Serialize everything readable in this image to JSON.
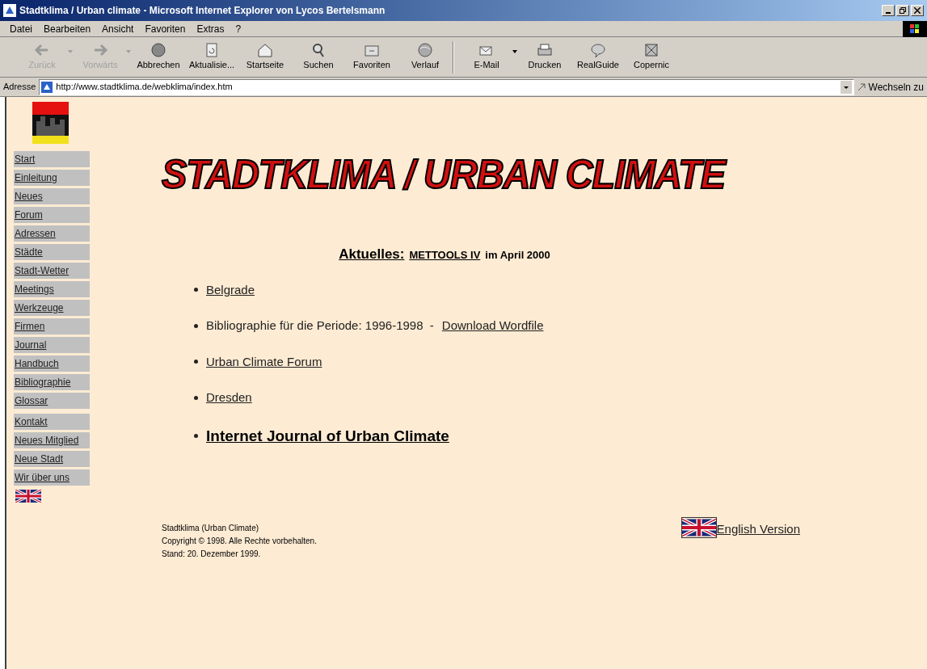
{
  "window": {
    "title": "Stadtklima / Urban climate - Microsoft Internet Explorer von Lycos Bertelsmann"
  },
  "menu": [
    "Datei",
    "Bearbeiten",
    "Ansicht",
    "Favoriten",
    "Extras",
    "?"
  ],
  "toolbar": [
    {
      "label": "Zurück",
      "kind": "back",
      "disabled": true,
      "dropdown": true
    },
    {
      "label": "Vorwärts",
      "kind": "forward",
      "disabled": true,
      "dropdown": true
    },
    {
      "label": "Abbrechen",
      "kind": "stop",
      "disabled": false,
      "dropdown": false
    },
    {
      "label": "Aktualisie...",
      "kind": "refresh",
      "disabled": false,
      "dropdown": false
    },
    {
      "label": "Startseite",
      "kind": "home",
      "disabled": false,
      "dropdown": false
    },
    {
      "label": "Suchen",
      "kind": "search",
      "disabled": false,
      "dropdown": false
    },
    {
      "label": "Favoriten",
      "kind": "favorites",
      "disabled": false,
      "dropdown": false
    },
    {
      "label": "Verlauf",
      "kind": "history",
      "disabled": false,
      "dropdown": false
    },
    {
      "label": "E-Mail",
      "kind": "mail",
      "disabled": false,
      "dropdown": true
    },
    {
      "label": "Drucken",
      "kind": "print",
      "disabled": false,
      "dropdown": false
    },
    {
      "label": "RealGuide",
      "kind": "realguide",
      "disabled": false,
      "dropdown": false
    },
    {
      "label": "Copernic",
      "kind": "copernic",
      "disabled": false,
      "dropdown": false
    }
  ],
  "address_bar": {
    "label": "Adresse",
    "url": "http://www.stadtklima.de/webklima/index.htm",
    "go": "Wechseln zu"
  },
  "sidebar": {
    "items": [
      "Start",
      "Einleitung",
      "Neues",
      "Forum",
      "Adressen",
      "Städte",
      "Stadt-Wetter",
      "Meetings",
      "Werkzeuge",
      "Firmen",
      "Journal",
      "Handbuch",
      "Bibliographie",
      "Glossar",
      "Kontakt",
      "Neues Mitglied",
      "Neue Stadt",
      "Wir über uns"
    ]
  },
  "banner": "STADTKLIMA / URBAN CLIMATE",
  "news": {
    "label": "Aktuelles:",
    "link": "METTOOLS IV",
    "text": "im April 2000"
  },
  "bullets": [
    {
      "kind": "link",
      "link": "Belgrade"
    },
    {
      "kind": "text_link",
      "text": "Bibliographie für die Periode: 1996-1998  -",
      "link": "Download Wordfile"
    },
    {
      "kind": "link",
      "link": "Urban Climate Forum"
    },
    {
      "kind": "link",
      "link": "Dresden"
    },
    {
      "kind": "big_link",
      "link": "Internet Journal of Urban Climate"
    }
  ],
  "footer": {
    "lines": [
      "Stadtklima (Urban Climate)",
      "Copyright © 1998. Alle Rechte vorbehalten.",
      "Stand: 20. Dezember 1999."
    ],
    "english_link": "English Version"
  }
}
